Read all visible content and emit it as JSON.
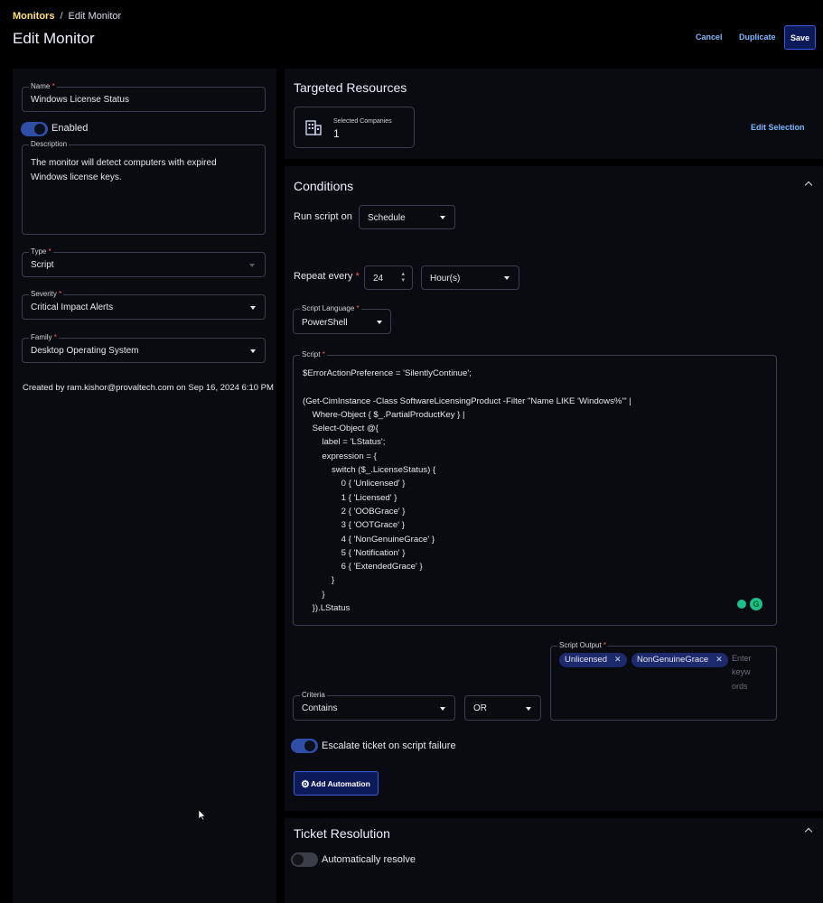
{
  "breadcrumb": {
    "parent": "Monitors",
    "separator": "/",
    "current": "Edit Monitor"
  },
  "page_title": "Edit Monitor",
  "toolbar": {
    "cancel": "Cancel",
    "duplicate": "Duplicate",
    "save": "Save"
  },
  "left": {
    "name": {
      "label": "Name",
      "value": "Windows License Status"
    },
    "enabled": {
      "label": "Enabled",
      "on": true
    },
    "description": {
      "label": "Description",
      "value": "The monitor will detect computers with expired Windows license keys."
    },
    "type": {
      "label": "Type",
      "value": "Script"
    },
    "severity": {
      "label": "Severity",
      "value": "Critical Impact Alerts"
    },
    "family": {
      "label": "Family",
      "value": "Desktop Operating System"
    },
    "created_by": "Created by ram.kishor@provaltech.com on Sep 16, 2024 6:10 PM"
  },
  "targeted": {
    "title": "Targeted Resources",
    "card_label": "Selected Companies",
    "card_count": "1",
    "edit_selection": "Edit Selection"
  },
  "conditions": {
    "title": "Conditions",
    "run_script_on_label": "Run script on",
    "run_script_on_value": "Schedule",
    "repeat_every_label": "Repeat every",
    "repeat_value": "24",
    "repeat_unit": "Hour(s)",
    "script_language_label": "Script Language",
    "script_language_value": "PowerShell",
    "script_label": "Script",
    "script_lines": [
      "$ErrorActionPreference = 'SilentlyContinue';",
      "",
      "(Get-CimInstance -Class SoftwareLicensingProduct -Filter \"Name LIKE 'Windows%'\" |",
      "    Where-Object { $_.PartialProductKey } |",
      "    Select-Object @{",
      "        label = 'LStatus';",
      "        expression = {",
      "            switch ($_.LicenseStatus) {",
      "                0 { 'Unlicensed' }",
      "                1 { 'Licensed' }",
      "                2 { 'OOBGrace' }",
      "                3 { 'OOTGrace' }",
      "                4 { 'NonGenuineGrace' }",
      "                5 { 'Notification' }",
      "                6 { 'ExtendedGrace' }",
      "            }",
      "        }",
      "    }).LStatus"
    ],
    "criteria_label": "Criteria",
    "criteria_value": "Contains",
    "logic_value": "OR",
    "script_output_label": "Script Output",
    "output_chips": [
      "Unlicensed",
      "NonGenuineGrace"
    ],
    "output_placeholder": "Enter keywords",
    "escalate_label": "Escalate ticket on script failure",
    "escalate_on": true,
    "add_automation": "Add Automation"
  },
  "ticket_resolution": {
    "title": "Ticket Resolution",
    "auto_resolve_label": "Automatically resolve",
    "auto_resolve_on": false
  },
  "colors": {
    "accent": "#2f4ea8",
    "link": "#7ab8ff",
    "breadcrumb": "#ffe27a",
    "required": "#ff5a5a"
  }
}
